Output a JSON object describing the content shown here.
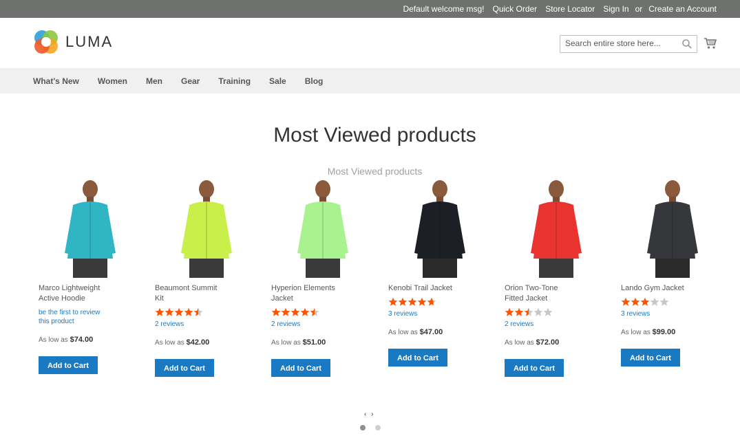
{
  "topbar": {
    "welcome": "Default welcome msg!",
    "quick_order": "Quick Order",
    "store_locator": "Store Locator",
    "sign_in": "Sign In",
    "or": "or",
    "create_account": "Create an Account"
  },
  "header": {
    "logo_text": "LUMA",
    "search_placeholder": "Search entire store here...",
    "search_icon": "search-icon",
    "cart_icon": "cart-icon"
  },
  "nav": {
    "items": [
      "What's New",
      "Women",
      "Men",
      "Gear",
      "Training",
      "Sale",
      "Blog"
    ]
  },
  "main": {
    "page_title": "Most Viewed products",
    "block_title": "Most Viewed products"
  },
  "products": [
    {
      "name_line1": "Marco Lightweight",
      "name_line2": "Active Hoodie",
      "rating": null,
      "review_line1": "be the first to review",
      "review_line2": "this product",
      "price_prefix": "As low as",
      "price": "$74.00",
      "button": "Add to Cart",
      "jacket_color": "#2fb5c4"
    },
    {
      "name_line1": "Beaumont Summit",
      "name_line2": "Kit",
      "rating": 4.5,
      "review_line1": "2 reviews",
      "price_prefix": "As low as",
      "price": "$42.00",
      "button": "Add to Cart",
      "jacket_color": "#c9ef4a"
    },
    {
      "name_line1": "Hyperion Elements",
      "name_line2": "Jacket",
      "rating": 4.5,
      "review_line1": "2 reviews",
      "price_prefix": "As low as",
      "price": "$51.00",
      "button": "Add to Cart",
      "jacket_color": "#a9f28f"
    },
    {
      "name_line1": "Kenobi Trail Jacket",
      "name_line2": "",
      "rating": 4.7,
      "review_line1": "3 reviews",
      "price_prefix": "As low as",
      "price": "$47.00",
      "button": "Add to Cart",
      "jacket_color": "#1c1f26"
    },
    {
      "name_line1": "Orion Two-Tone",
      "name_line2": "Fitted Jacket",
      "rating": 2.5,
      "review_line1": "2 reviews",
      "price_prefix": "As low as",
      "price": "$72.00",
      "button": "Add to Cart",
      "jacket_color": "#e8332f"
    },
    {
      "name_line1": "Lando Gym Jacket",
      "name_line2": "",
      "rating": 3,
      "review_line1": "3 reviews",
      "price_prefix": "As low as",
      "price": "$99.00",
      "button": "Add to Cart",
      "jacket_color": "#35373a"
    }
  ],
  "slider": {
    "prev": "‹",
    "next": "›",
    "dot_count": 2,
    "active_dot": 0
  },
  "colors": {
    "accent": "#1979c3",
    "star": "#ff5501",
    "star_empty": "#c7c7c7"
  }
}
